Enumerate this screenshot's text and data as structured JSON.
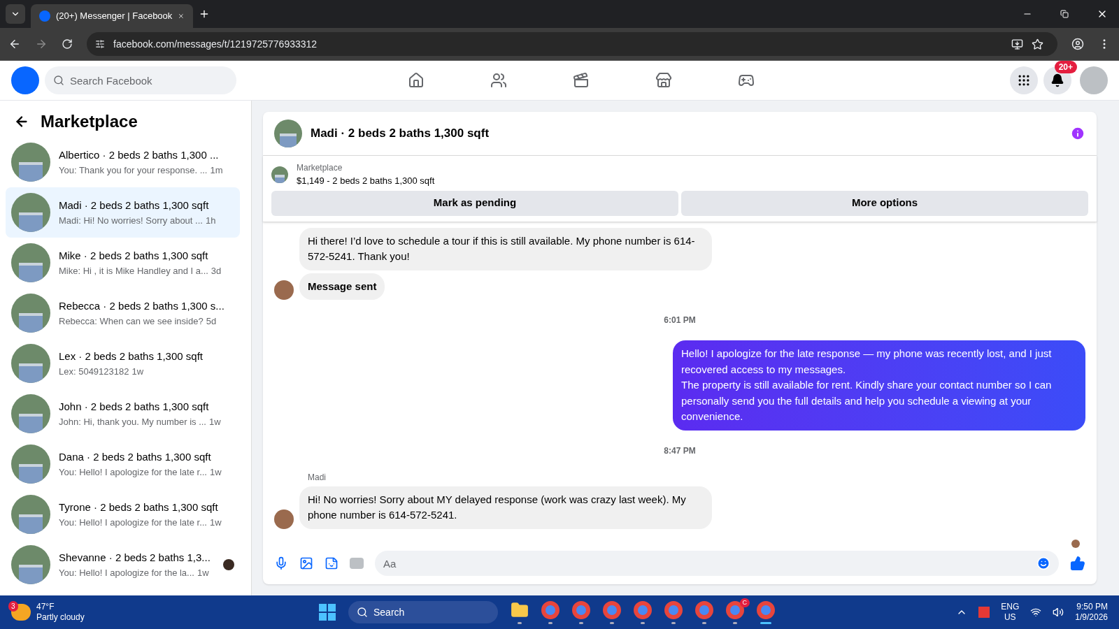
{
  "browser": {
    "tab_title": "(20+) Messenger | Facebook",
    "url": "facebook.com/messages/t/1219725776933312"
  },
  "header": {
    "search": {
      "placeholder": "Search Facebook"
    },
    "nav": [
      {
        "kind": "home",
        "selected": false
      },
      {
        "kind": "friends",
        "selected": false
      },
      {
        "kind": "video",
        "selected": false
      },
      {
        "kind": "marketplace",
        "selected": false
      },
      {
        "kind": "gaming",
        "selected": false
      }
    ],
    "notification_badge": "20+"
  },
  "sidebar": {
    "title": "Marketplace",
    "conversations": [
      {
        "title": "Albertico · 2 beds 2 baths 1,300 ...",
        "preview": "You: Thank you for your response. ...",
        "time": "1m",
        "selected": false,
        "seen_avatar": false
      },
      {
        "title": "Madi · 2 beds 2 baths 1,300 sqft",
        "preview": "Madi: Hi! No worries! Sorry about ...",
        "time": "1h",
        "selected": true,
        "seen_avatar": false
      },
      {
        "title": "Mike · 2 beds 2 baths 1,300 sqft",
        "preview": "Mike: Hi , it is Mike Handley and I a...",
        "time": "3d",
        "selected": false,
        "seen_avatar": false
      },
      {
        "title": "Rebecca · 2 beds 2 baths 1,300 s...",
        "preview": "Rebecca: When can we see inside?",
        "time": "5d",
        "selected": false,
        "seen_avatar": false
      },
      {
        "title": "Lex · 2 beds 2 baths 1,300 sqft",
        "preview": "Lex: 5049123182",
        "time": "1w",
        "selected": false,
        "seen_avatar": false
      },
      {
        "title": "John · 2 beds 2 baths 1,300 sqft",
        "preview": "John: Hi, thank you. My number is ...",
        "time": "1w",
        "selected": false,
        "seen_avatar": false
      },
      {
        "title": "Dana · 2 beds 2 baths 1,300 sqft",
        "preview": "You: Hello! I apologize for the late r...",
        "time": "1w",
        "selected": false,
        "seen_avatar": false
      },
      {
        "title": "Tyrone · 2 beds 2 baths 1,300 sqft",
        "preview": "You: Hello! I apologize for the late r...",
        "time": "1w",
        "selected": false,
        "seen_avatar": false
      },
      {
        "title": "Shevanne · 2 beds 2 baths 1,3...",
        "preview": "You: Hello! I apologize for the la...",
        "time": "1w",
        "selected": false,
        "seen_avatar": true
      }
    ]
  },
  "chat": {
    "title": "Madi · 2 beds 2 baths 1,300 sqft",
    "listing": {
      "source": "Marketplace",
      "summary": "$1,149 - 2 beds 2 baths 1,300 sqft"
    },
    "buttons": [
      "Mark as pending",
      "More options"
    ],
    "messages": [
      {
        "kind": "incoming",
        "text": "Hi there! I’d love to schedule a tour if this is still available. My phone number is 614-572-5241. Thank you!",
        "avatar": false,
        "bold": false
      },
      {
        "kind": "incoming",
        "text": "Message sent",
        "avatar": true,
        "bold": true
      },
      {
        "kind": "timestamp",
        "text": "6:01 PM"
      },
      {
        "kind": "outgoing",
        "text": "Hello! I apologize for the late response — my phone was recently lost, and I just recovered access to my messages.\nThe property is still available for rent. Kindly share your contact number so I can personally send you the full details and help you schedule a viewing at your convenience."
      },
      {
        "kind": "timestamp",
        "text": "8:47 PM"
      },
      {
        "kind": "incoming",
        "sender": "Madi",
        "text": "Hi! No worries! Sorry about MY delayed response (work was crazy last week). My phone number is 614-572-5241.",
        "avatar": true,
        "bold": false
      }
    ],
    "composer": {
      "placeholder": "Aa"
    }
  },
  "taskbar": {
    "weather": {
      "temp": "47°F",
      "condition": "Partly cloudy",
      "badge": "3"
    },
    "search": {
      "placeholder": "Search"
    },
    "apps": [
      {
        "kind": "folder",
        "active": false
      },
      {
        "kind": "browser",
        "active": false
      },
      {
        "kind": "browser",
        "active": false
      },
      {
        "kind": "browser",
        "active": false
      },
      {
        "kind": "browser",
        "active": false
      },
      {
        "kind": "browser",
        "active": false
      },
      {
        "kind": "browser",
        "active": false
      },
      {
        "kind": "browser",
        "active": false,
        "badge": "C"
      },
      {
        "kind": "browser",
        "active": true
      }
    ],
    "lang": "ENG",
    "region": "US",
    "time": "9:50 PM",
    "date": "1/9/2026"
  }
}
